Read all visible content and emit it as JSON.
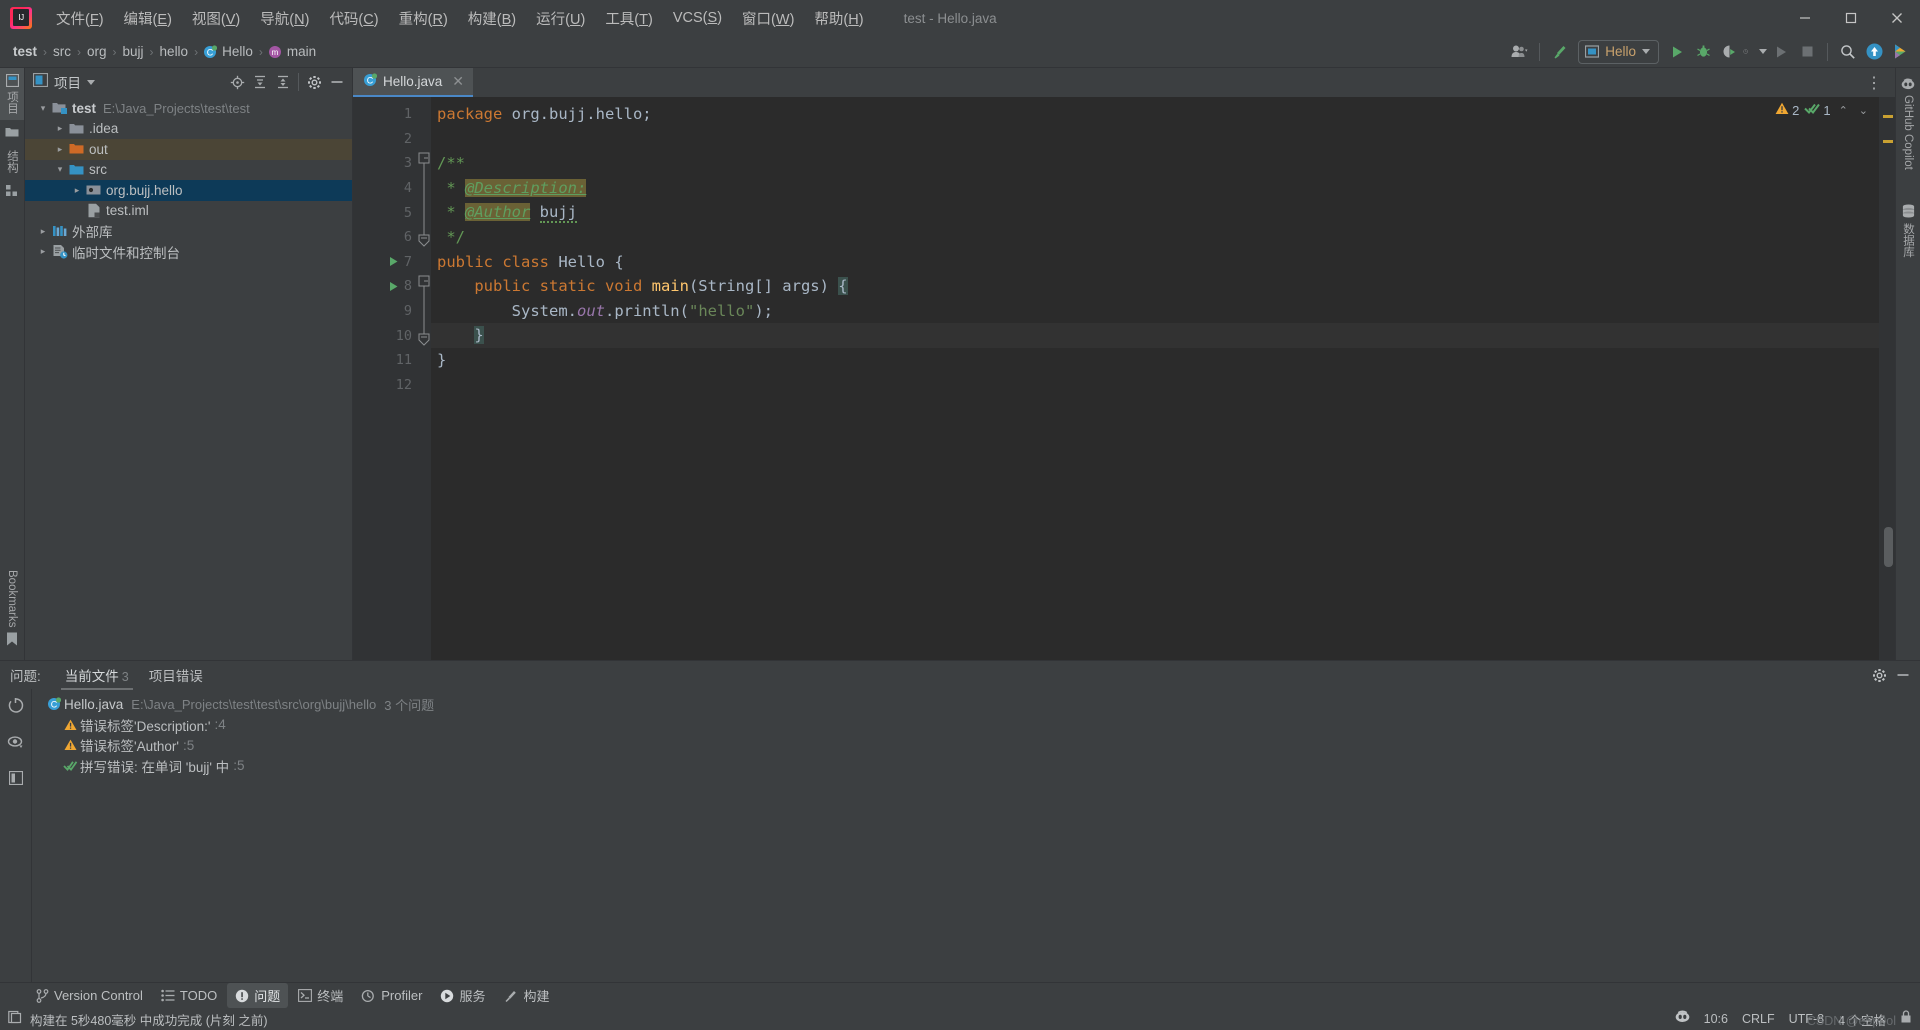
{
  "window": {
    "title": "test - Hello.java",
    "minimize": "—",
    "maximize": "❐",
    "close": "✕"
  },
  "menu": {
    "items": [
      {
        "label": "文件",
        "mnemonic": "F"
      },
      {
        "label": "编辑",
        "mnemonic": "E"
      },
      {
        "label": "视图",
        "mnemonic": "V"
      },
      {
        "label": "导航",
        "mnemonic": "N"
      },
      {
        "label": "代码",
        "mnemonic": "C"
      },
      {
        "label": "重构",
        "mnemonic": "R"
      },
      {
        "label": "构建",
        "mnemonic": "B"
      },
      {
        "label": "运行",
        "mnemonic": "U"
      },
      {
        "label": "工具",
        "mnemonic": "T"
      },
      {
        "label": "VCS",
        "mnemonic": "S"
      },
      {
        "label": "窗口",
        "mnemonic": "W"
      },
      {
        "label": "帮助",
        "mnemonic": "H"
      }
    ]
  },
  "navbar": {
    "breadcrumbs": [
      "test",
      "src",
      "org",
      "bujj",
      "hello",
      "Hello",
      "main"
    ],
    "separator": "›",
    "run_config": "Hello",
    "icons": {
      "account": "account-icon",
      "build": "hammer-icon",
      "run": "run-icon",
      "debug": "debug-icon",
      "coverage": "run-with-coverage-icon",
      "profiler": "profiler-icon",
      "rerun": "rerun-icon",
      "stop": "stop-icon",
      "search": "search-icon",
      "update": "update-project-icon",
      "assistant": "ai-assistant-icon"
    }
  },
  "left_stripe": {
    "project_label": "项目",
    "structure_label": "结构",
    "bookmarks_label": "Bookmarks"
  },
  "right_stripe": {
    "copilot_label": "GitHub Copilot",
    "database_label": "数据库"
  },
  "project_panel": {
    "title": "项目",
    "actions": [
      "select-opened-file-icon",
      "expand-all-icon",
      "collapse-all-icon",
      "settings-icon",
      "hide-icon"
    ],
    "tree": [
      {
        "label": "test",
        "path": "E:\\Java_Projects\\test\\test",
        "indent": 0,
        "arrow": "⌄",
        "icon": "module-folder",
        "bold": true,
        "state": "normal"
      },
      {
        "label": ".idea",
        "path": "",
        "indent": 1,
        "arrow": "›",
        "icon": "folder",
        "bold": false,
        "state": "normal"
      },
      {
        "label": "out",
        "path": "",
        "indent": 1,
        "arrow": "›",
        "icon": "folder-orange",
        "bold": false,
        "state": "highlight"
      },
      {
        "label": "src",
        "path": "",
        "indent": 1,
        "arrow": "⌄",
        "icon": "folder-blue",
        "bold": false,
        "state": "normal"
      },
      {
        "label": "org.bujj.hello",
        "path": "",
        "indent": 2,
        "arrow": "›",
        "icon": "package",
        "bold": false,
        "state": "selected"
      },
      {
        "label": "test.iml",
        "path": "",
        "indent": 2,
        "arrow": "",
        "icon": "iml-file",
        "bold": false,
        "state": "normal"
      },
      {
        "label": "外部库",
        "path": "",
        "indent": 0,
        "arrow": "›",
        "icon": "library",
        "bold": false,
        "state": "normal"
      },
      {
        "label": "临时文件和控制台",
        "path": "",
        "indent": 0,
        "arrow": "›",
        "icon": "scratches",
        "bold": false,
        "state": "normal"
      }
    ]
  },
  "editor": {
    "tab": {
      "name": "Hello.java",
      "icon": "java-class-icon",
      "close": "✕"
    },
    "options_icon": "more-options-icon",
    "inspections": {
      "warning_count": "2",
      "check_count": "1",
      "up": "⌃",
      "down": "⌄"
    },
    "line_numbers": [
      "1",
      "2",
      "3",
      "4",
      "5",
      "6",
      "7",
      "8",
      "9",
      "10",
      "11",
      "12"
    ],
    "caret_position": "10:6",
    "lines": [
      {
        "n": 1,
        "runnable": false,
        "fold": "",
        "tokens": [
          {
            "t": "package ",
            "c": "kw"
          },
          {
            "t": "org.bujj.hello;",
            "c": "plain"
          }
        ]
      },
      {
        "n": 2,
        "runnable": false,
        "fold": "",
        "tokens": []
      },
      {
        "n": 3,
        "runnable": false,
        "fold": "open",
        "tokens": [
          {
            "t": "/**",
            "c": "cmt"
          }
        ]
      },
      {
        "n": 4,
        "runnable": false,
        "fold": "",
        "tokens": [
          {
            "t": " * ",
            "c": "cmt"
          },
          {
            "t": "@Description:",
            "c": "tagname"
          }
        ]
      },
      {
        "n": 5,
        "runnable": false,
        "fold": "",
        "tokens": [
          {
            "t": " * ",
            "c": "cmt"
          },
          {
            "t": "@Author",
            "c": "tagname"
          },
          {
            "t": " ",
            "c": "cmt"
          },
          {
            "t": "bujj",
            "c": "typo"
          }
        ]
      },
      {
        "n": 6,
        "runnable": false,
        "fold": "close",
        "tokens": [
          {
            "t": " */",
            "c": "cmt"
          }
        ]
      },
      {
        "n": 7,
        "runnable": true,
        "fold": "",
        "tokens": [
          {
            "t": "public class ",
            "c": "kw"
          },
          {
            "t": "Hello ",
            "c": "plain"
          },
          {
            "t": "{",
            "c": "plain"
          }
        ]
      },
      {
        "n": 8,
        "runnable": true,
        "fold": "open",
        "tokens": [
          {
            "t": "    ",
            "c": "plain"
          },
          {
            "t": "public static void ",
            "c": "kw"
          },
          {
            "t": "main",
            "c": "mth"
          },
          {
            "t": "(String[] args) ",
            "c": "plain"
          },
          {
            "t": "{",
            "c": "brace"
          }
        ]
      },
      {
        "n": 9,
        "runnable": false,
        "fold": "",
        "tokens": [
          {
            "t": "        System.",
            "c": "plain"
          },
          {
            "t": "out",
            "c": "fld"
          },
          {
            "t": ".println(",
            "c": "plain"
          },
          {
            "t": "\"hello\"",
            "c": "str"
          },
          {
            "t": ");",
            "c": "plain"
          }
        ]
      },
      {
        "n": 10,
        "runnable": false,
        "fold": "close",
        "tokens": [
          {
            "t": "    ",
            "c": "plain"
          },
          {
            "t": "}",
            "c": "brace"
          }
        ]
      },
      {
        "n": 11,
        "runnable": false,
        "fold": "",
        "tokens": [
          {
            "t": "}",
            "c": "plain"
          }
        ]
      },
      {
        "n": 12,
        "runnable": false,
        "fold": "",
        "tokens": []
      }
    ]
  },
  "problems": {
    "label": "问题:",
    "tabs": [
      {
        "label": "当前文件",
        "count": "3",
        "active": true
      },
      {
        "label": "项目错误",
        "count": "",
        "active": false
      }
    ],
    "actions": [
      "settings-icon",
      "hide-icon"
    ],
    "stripe_icons": [
      "inspections-icon",
      "preview-icon",
      "layout-icon"
    ],
    "file": {
      "name": "Hello.java",
      "path": "E:\\Java_Projects\\test\\test\\src\\org\\bujj\\hello",
      "summary": "3 个问题"
    },
    "items": [
      {
        "severity": "warning",
        "text": "错误标签'Description:'",
        "line": ":4"
      },
      {
        "severity": "warning",
        "text": "错误标签'Author'",
        "line": ":5"
      },
      {
        "severity": "typo",
        "text": "拼写错误: 在单词 'bujj' 中",
        "line": ":5"
      }
    ]
  },
  "toolwindow_bar": {
    "buttons": [
      {
        "label": "Version Control",
        "icon": "branch-icon",
        "active": false
      },
      {
        "label": "TODO",
        "icon": "todo-icon",
        "active": false
      },
      {
        "label": "问题",
        "icon": "problems-icon",
        "active": true
      },
      {
        "label": "终端",
        "icon": "terminal-icon",
        "active": false
      },
      {
        "label": "Profiler",
        "icon": "profiler-icon",
        "active": false
      },
      {
        "label": "服务",
        "icon": "services-icon",
        "active": false
      },
      {
        "label": "构建",
        "icon": "build-icon",
        "active": false
      }
    ]
  },
  "statusbar": {
    "message": "构建在 5秒480毫秒 中成功完成 (片刻 之前)",
    "message_icon": "build-status-icon",
    "items": [
      {
        "label": "10:6",
        "name": "caret-position"
      },
      {
        "label": "CRLF",
        "name": "line-separator"
      },
      {
        "label": "UTF-8",
        "name": "file-encoding"
      },
      {
        "label": "4 个空格",
        "name": "indent-setting"
      }
    ],
    "copilot_icon": "copilot-status-icon",
    "watermark": "CSDN @e5p0ol"
  },
  "colors": {
    "bg_panel": "#3c3f41",
    "bg_editor": "#2b2b2b",
    "bg_gutter": "#313335",
    "selection": "#0d3a58",
    "accent_tab": "#4a88c7",
    "keyword": "#cc7832",
    "string": "#6a8759",
    "comment": "#629755",
    "field": "#9876aa",
    "method": "#ffc66d",
    "warning": "#f0a732",
    "run_green": "#59a869"
  }
}
